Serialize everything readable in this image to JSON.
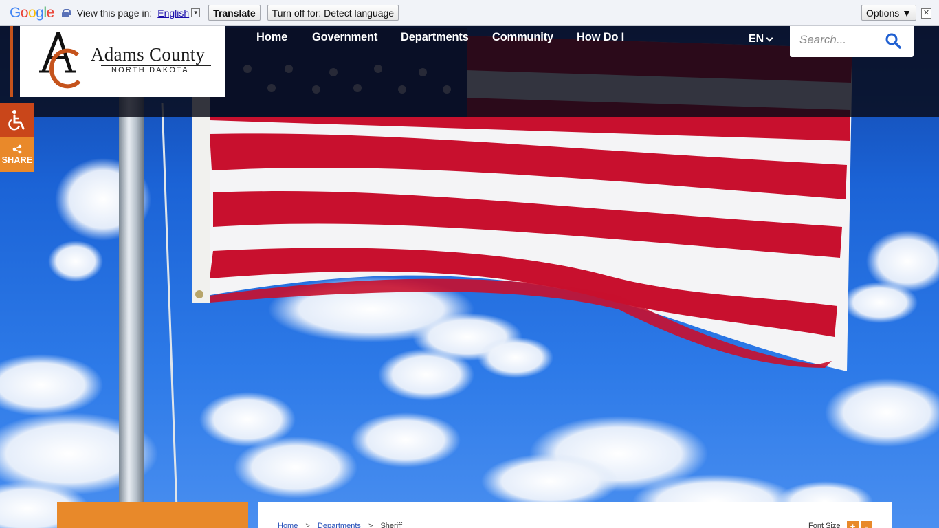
{
  "translate_bar": {
    "logo": [
      "G",
      "o",
      "o",
      "g",
      "l",
      "e"
    ],
    "logo_colors": [
      "#4285F4",
      "#EA4335",
      "#FBBC05",
      "#4285F4",
      "#34A853",
      "#EA4335"
    ],
    "prompt": "View this page in:",
    "language": "English",
    "translate_label": "Translate",
    "turn_off_label": "Turn off for: Detect language",
    "options_label": "Options ▼",
    "close_glyph": "✕"
  },
  "site": {
    "name": "Adams County",
    "subtitle": "NORTH DAKOTA",
    "accent_color": "#c5531c",
    "secondary_color": "#e8892a"
  },
  "nav": {
    "items": [
      {
        "label": "Home"
      },
      {
        "label": "Government"
      },
      {
        "label": "Departments"
      },
      {
        "label": "Community"
      },
      {
        "label": "How Do I"
      }
    ],
    "language": "EN"
  },
  "search": {
    "placeholder": "Search..."
  },
  "side": {
    "accessibility_icon": "wheelchair-icon",
    "share_label": "SHARE",
    "share_icon": "share-icon"
  },
  "breadcrumb": {
    "items": [
      "Home",
      "Departments",
      "Sheriff"
    ],
    "separator": ">"
  },
  "font_size": {
    "label": "Font Size",
    "increase": "+",
    "decrease": "-"
  }
}
